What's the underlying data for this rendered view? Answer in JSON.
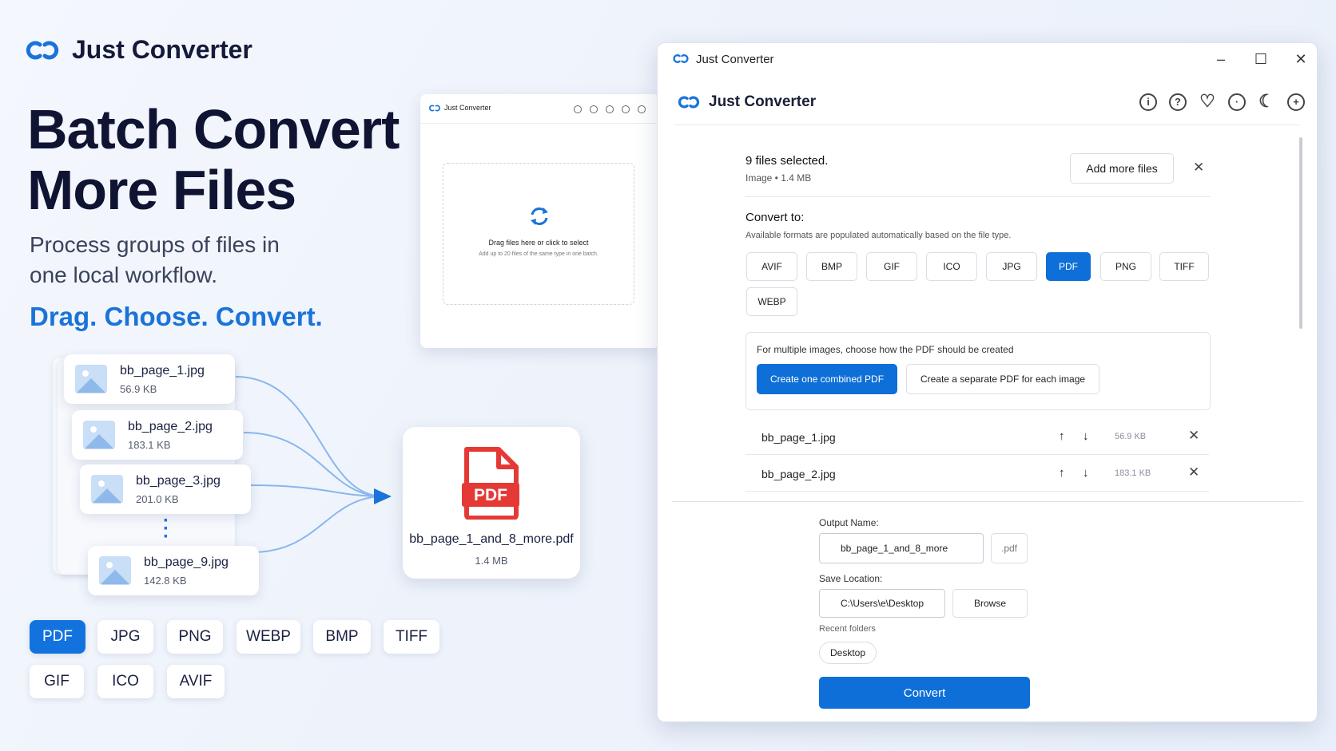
{
  "hero": {
    "brand": "Just Converter",
    "title": "Batch Convert More Files",
    "subtitle": "Process groups of files in one local workflow.",
    "tagline": "Drag. Choose. Convert."
  },
  "input_files": [
    {
      "name": "bb_page_1.jpg",
      "size": "56.9 KB"
    },
    {
      "name": "bb_page_2.jpg",
      "size": "183.1 KB"
    },
    {
      "name": "bb_page_3.jpg",
      "size": "201.0 KB"
    },
    {
      "name": "bb_page_9.jpg",
      "size": "142.8 KB"
    }
  ],
  "output_file": {
    "name": "bb_page_1_and_8_more.pdf",
    "size": "1.4 MB",
    "badge": "PDF"
  },
  "format_chips": [
    "PDF",
    "JPG",
    "PNG",
    "WEBP",
    "BMP",
    "TIFF",
    "GIF",
    "ICO",
    "AVIF"
  ],
  "mini_window": {
    "title": "Just Converter",
    "drop_title": "Drag files here or click to select",
    "drop_hint": "Add up to 20 files of the same type in one batch."
  },
  "window": {
    "title": "Just Converter",
    "app_name": "Just Converter",
    "selection": {
      "count": "9 files selected.",
      "meta": "Image • 1.4 MB",
      "add_more": "Add more files"
    },
    "convert_to": {
      "label": "Convert to:",
      "hint": "Available formats are populated automatically based on the file type.",
      "formats": [
        "AVIF",
        "BMP",
        "GIF",
        "ICO",
        "JPG",
        "PDF",
        "PNG",
        "TIFF",
        "WEBP"
      ],
      "selected": "PDF"
    },
    "pdf_mode": {
      "label": "For multiple images, choose how the PDF should be created",
      "combined": "Create one combined PDF",
      "separate": "Create a separate PDF for each image"
    },
    "file_rows": [
      {
        "name": "bb_page_1.jpg",
        "size": "56.9 KB"
      },
      {
        "name": "bb_page_2.jpg",
        "size": "183.1 KB"
      }
    ],
    "output": {
      "name_label": "Output Name:",
      "name_value": "bb_page_1_and_8_more",
      "extension": ".pdf",
      "location_label": "Save Location:",
      "location_value": "C:\\Users\\e\\Desktop",
      "browse": "Browse",
      "recent_label": "Recent folders",
      "recent": [
        "Desktop"
      ],
      "convert": "Convert"
    }
  },
  "colors": {
    "accent": "#0f6fd8",
    "pdf_red": "#e53935",
    "title": "#0f1433",
    "tagline": "#1a73d9"
  }
}
